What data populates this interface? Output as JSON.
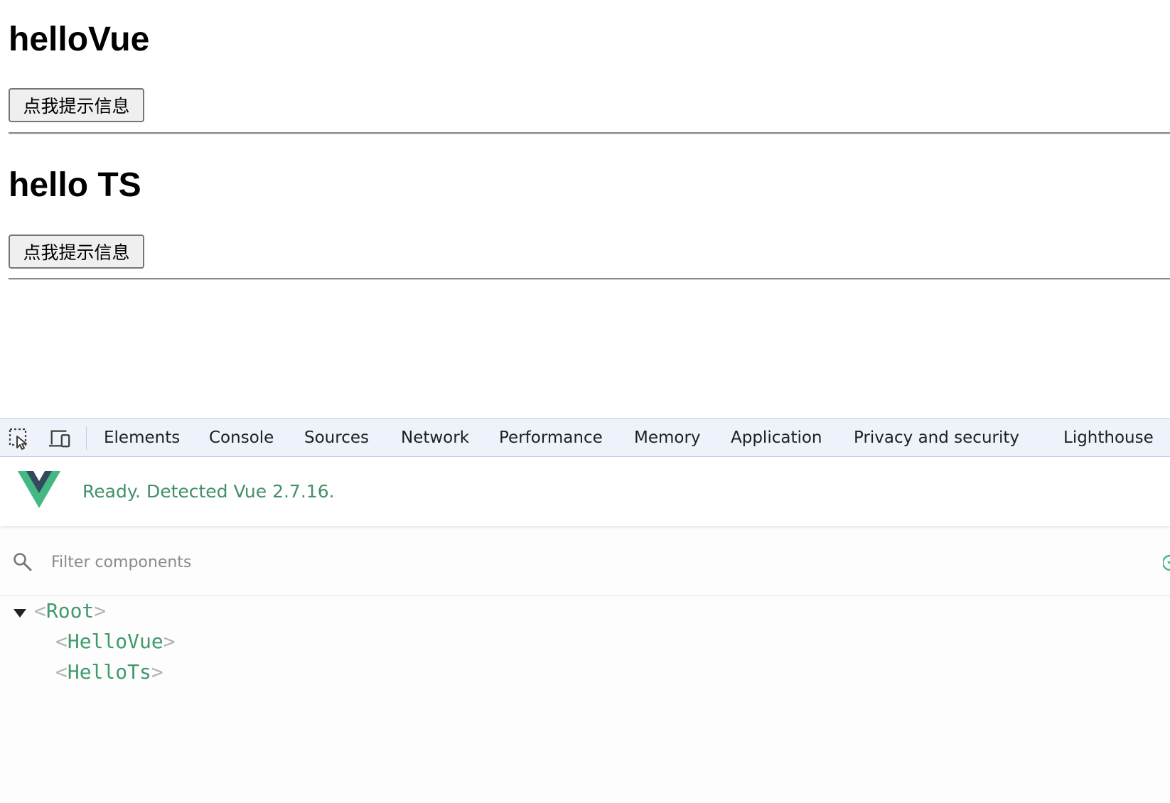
{
  "page": {
    "sections": [
      {
        "title": "helloVue",
        "button_label": "点我提示信息"
      },
      {
        "title": "hello TS",
        "button_label": "点我提示信息"
      }
    ]
  },
  "devtools": {
    "tabs": [
      "Elements",
      "Console",
      "Sources",
      "Network",
      "Performance",
      "Memory",
      "Application",
      "Privacy and security",
      "Lighthouse"
    ],
    "icons": {
      "inspect": "inspect-element-icon",
      "device": "device-toolbar-icon",
      "search": "search-icon"
    },
    "vue": {
      "status": "Ready. Detected Vue 2.7.16.",
      "filter_placeholder": "Filter components",
      "tree": {
        "root": {
          "open": "<",
          "name": "Root",
          "close": ">"
        },
        "children": [
          {
            "open": "<",
            "name": "HelloVue",
            "close": ">"
          },
          {
            "open": "<",
            "name": "HelloTs",
            "close": ">"
          }
        ]
      }
    },
    "colors": {
      "vue_green": "#42b883",
      "vue_dark": "#35495e",
      "tag_green": "#3f9a6c",
      "tabbar_bg": "#edf2fb"
    }
  }
}
